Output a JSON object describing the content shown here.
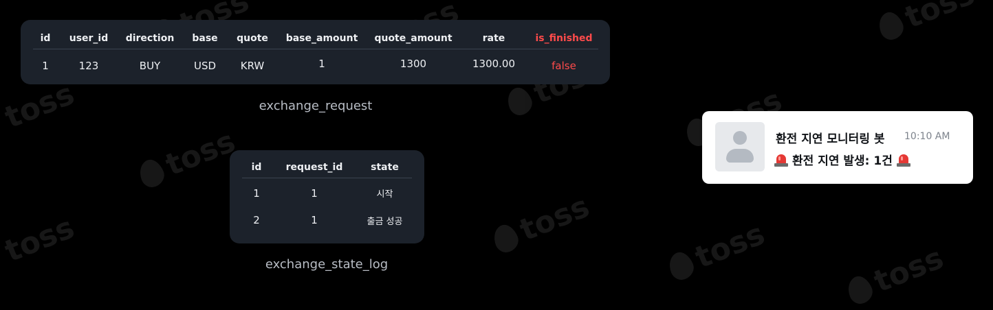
{
  "exchange_request": {
    "columns": [
      "id",
      "user_id",
      "direction",
      "base",
      "quote",
      "base_amount",
      "quote_amount",
      "rate",
      "is_finished"
    ],
    "row": [
      "1",
      "123",
      "BUY",
      "USD",
      "KRW",
      "1",
      "1300",
      "1300.00",
      "false"
    ],
    "caption": "exchange_request"
  },
  "exchange_state_log": {
    "columns": [
      "id",
      "request_id",
      "state"
    ],
    "rows": [
      [
        "1",
        "1",
        "시작"
      ],
      [
        "2",
        "1",
        "출금 성공"
      ]
    ],
    "caption": "exchange_state_log"
  },
  "notification": {
    "bot_name": "환전 지연 모니터링 봇",
    "time": "10:10 AM",
    "message": "환전 지연 발생: 1건",
    "icon": "siren-icon"
  },
  "watermark": {
    "text": "toss"
  },
  "colors": {
    "highlight": "#ff4b4b",
    "card": "#1c222b",
    "background": "#000000"
  }
}
